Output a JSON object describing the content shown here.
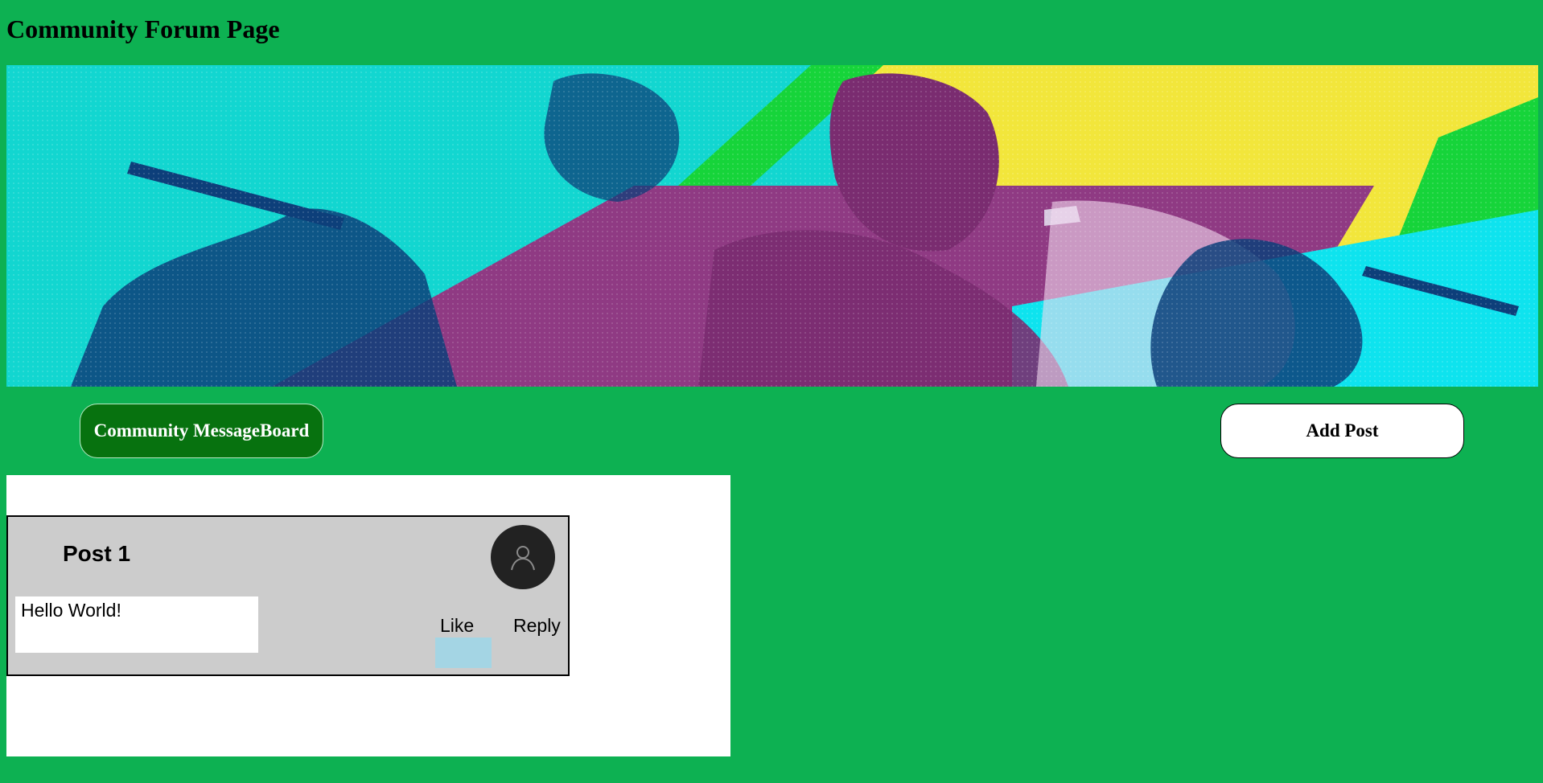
{
  "page": {
    "title": "Community Forum Page"
  },
  "banner": {
    "image": "concert-singers-collage",
    "colors": {
      "cyan": "#12d6d0",
      "magenta": "#8f3a83",
      "yellow": "#f2e63b",
      "green": "#16d43a",
      "navy": "#0d3f7a"
    }
  },
  "nav": {
    "board_label": "Community MessageBoard",
    "add_post_label": "Add Post"
  },
  "posts": [
    {
      "title": "Post 1",
      "body": "Hello World!",
      "like_label": "Like",
      "reply_label": "Reply",
      "avatar_icon": "user-icon"
    }
  ],
  "colors": {
    "background": "#0db152",
    "board_button": "#07720f",
    "card": "#cccccc",
    "like_button": "#a4d5e4"
  }
}
